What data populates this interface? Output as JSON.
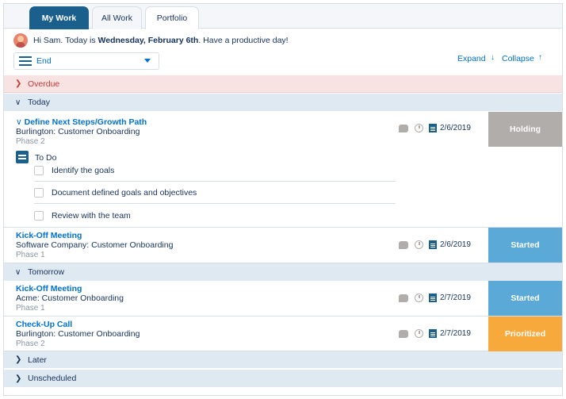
{
  "tabs": [
    {
      "label": "My Work",
      "active": true
    },
    {
      "label": "All Work",
      "active": false
    },
    {
      "label": "Portfolio",
      "active": false
    }
  ],
  "greeting": {
    "prefix": "Hi Sam. Today is",
    "date": "Wednesday, February 6th",
    "suffix": ". Have a productive day!"
  },
  "sort": {
    "selected": "End"
  },
  "controls": {
    "expand_label": "Expand",
    "collapse_label": "Collapse"
  },
  "sections": {
    "overdue": "Overdue",
    "today": "Today",
    "tomorrow": "Tomorrow",
    "later": "Later",
    "unscheduled": "Unscheduled"
  },
  "tasks": [
    {
      "title": "Define Next Steps/Growth Path",
      "project": "Burlington: Customer Onboarding",
      "phase": "Phase 2",
      "date": "2/6/2019",
      "status": "Holding",
      "status_color": "#b0adab"
    },
    {
      "title": "Kick-Off Meeting",
      "project": "Software Company: Customer Onboarding",
      "phase": "Phase 1",
      "date": "2/6/2019",
      "status": "Started",
      "status_color": "#5aa9d6"
    },
    {
      "title": "Kick-Off Meeting",
      "project": "Acme: Customer Onboarding",
      "phase": "Phase 1",
      "date": "2/7/2019",
      "status": "Started",
      "status_color": "#5aa9d6"
    },
    {
      "title": "Check-Up Call",
      "project": "Burlington: Customer Onboarding",
      "phase": "Phase 2",
      "date": "2/7/2019",
      "status": "Prioritized",
      "status_color": "#f8a93c"
    }
  ],
  "todo": {
    "label": "To Do",
    "items": [
      "Identify the goals",
      "Document defined goals and objectives",
      "Review with the team"
    ]
  }
}
